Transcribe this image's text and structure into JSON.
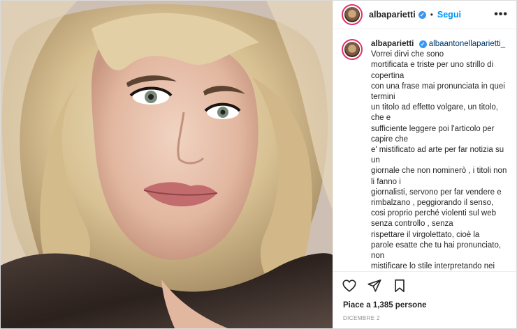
{
  "header": {
    "username": "albaparietti",
    "follow_label": "Segui",
    "dot": "•",
    "more_label": "•••"
  },
  "caption": {
    "username": "albaparietti",
    "mention": "albaantonellaparietti_",
    "lines": [
      "Vorrei dirvi che sono",
      "mortificata e triste per uno strillo di copertina",
      "con una frase mai pronunciata in quei termini",
      "un titolo ad effetto volgare, un titolo, che e",
      "sufficiente leggere poi l'articolo per capire che",
      "e' mistificato ad arte per far notizia su un",
      "giornale che non nominerò , i titoli non li fanno i",
      "giornalisti, servono per far vendere e",
      "rimbalzano , peggiorando il senso,",
      "cosi proprio perché violenti sul web",
      "senza controllo , senza",
      "rispettare il virgolettato, cioè la",
      "parole esatte che tu hai pronunciato, non",
      "mistificare lo stile interpretando nei"
    ]
  },
  "actions": {
    "like_icon": "heart-icon",
    "share_icon": "paper-plane-icon",
    "save_icon": "bookmark-icon"
  },
  "likes_text": "Piace a 1,385 persone",
  "date_text": "DICEMBRE 2",
  "colors": {
    "follow": "#0095f6",
    "verified": "#3897f0",
    "text": "#262626",
    "muted": "#8e8e8e",
    "border": "#dbdbdb"
  }
}
